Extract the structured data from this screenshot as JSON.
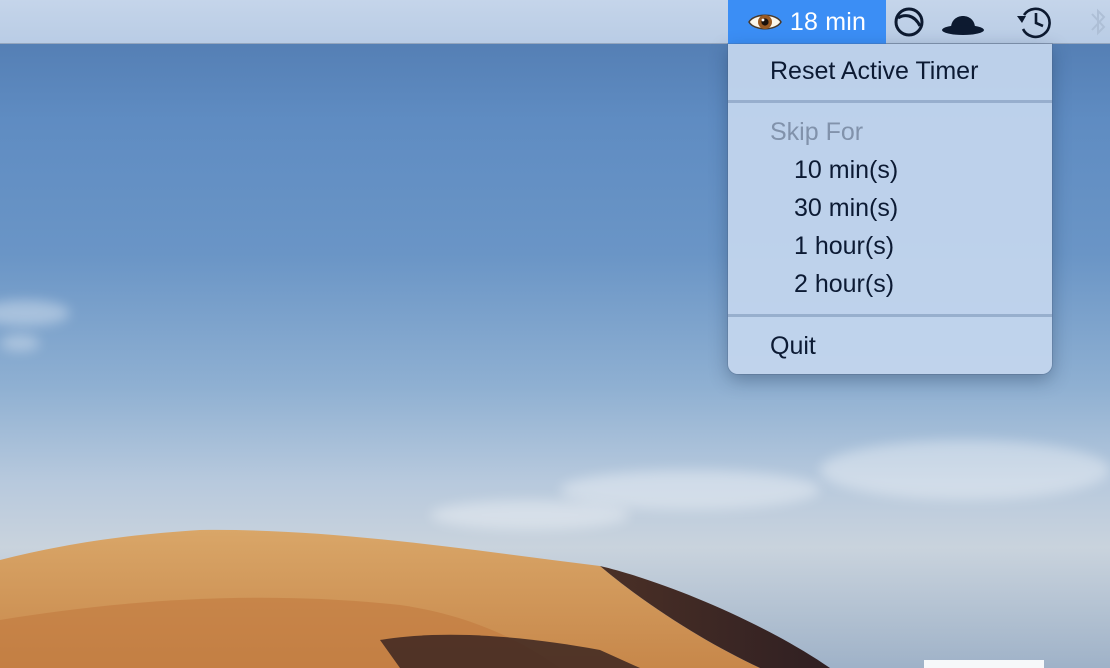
{
  "menubar": {
    "timer": {
      "icon": "eye-icon",
      "label": "18 min",
      "highlight_color": "#3b8ef5"
    },
    "icons": [
      "circle-slash-icon",
      "bowler-hat-icon",
      "time-machine-icon",
      "bluetooth-icon"
    ]
  },
  "menu": {
    "reset_label": "Reset Active Timer",
    "skip_header": "Skip For",
    "skip_options": [
      "10 min(s)",
      "30 min(s)",
      "1 hour(s)",
      "2 hour(s)"
    ],
    "quit_label": "Quit"
  }
}
